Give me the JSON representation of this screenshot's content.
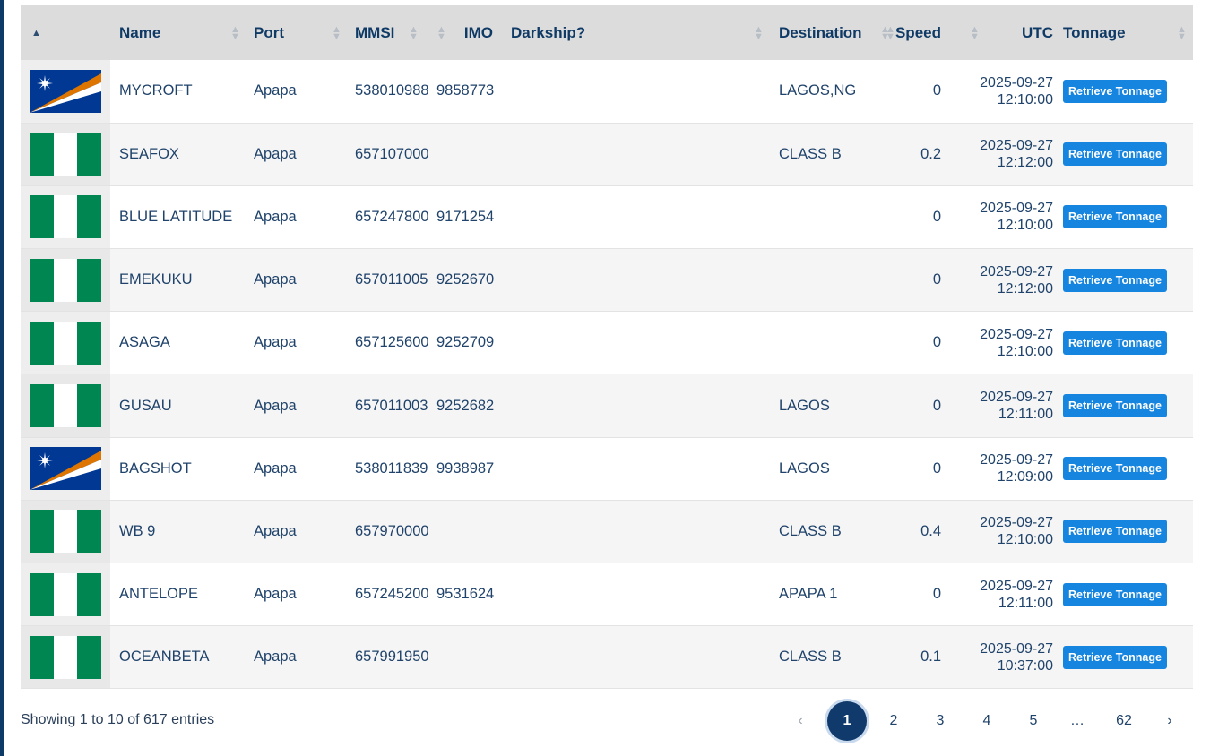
{
  "columns": {
    "name": "Name",
    "port": "Port",
    "mmsi": "MMSI",
    "imo": "IMO",
    "darkship": "Darkship?",
    "destination": "Destination",
    "speed": "Speed",
    "utc": "UTC",
    "tonnage": "Tonnage"
  },
  "button_label": "Retrieve Tonnage",
  "rows": [
    {
      "flag": "marshall-islands",
      "name": "MYCROFT",
      "port": "Apapa",
      "mmsi": "538010988",
      "imo": "9858773",
      "darkship": "",
      "destination": "LAGOS,NG",
      "speed": "0",
      "utc_date": "2025-09-27",
      "utc_time": "12:10:00"
    },
    {
      "flag": "nigeria",
      "name": "SEAFOX",
      "port": "Apapa",
      "mmsi": "657107000",
      "imo": "",
      "darkship": "",
      "destination": "CLASS B",
      "speed": "0.2",
      "utc_date": "2025-09-27",
      "utc_time": "12:12:00"
    },
    {
      "flag": "nigeria",
      "name": "BLUE LATITUDE",
      "port": "Apapa",
      "mmsi": "657247800",
      "imo": "9171254",
      "darkship": "",
      "destination": "",
      "speed": "0",
      "utc_date": "2025-09-27",
      "utc_time": "12:10:00"
    },
    {
      "flag": "nigeria",
      "name": "EMEKUKU",
      "port": "Apapa",
      "mmsi": "657011005",
      "imo": "9252670",
      "darkship": "",
      "destination": "",
      "speed": "0",
      "utc_date": "2025-09-27",
      "utc_time": "12:12:00"
    },
    {
      "flag": "nigeria",
      "name": "ASAGA",
      "port": "Apapa",
      "mmsi": "657125600",
      "imo": "9252709",
      "darkship": "",
      "destination": "",
      "speed": "0",
      "utc_date": "2025-09-27",
      "utc_time": "12:10:00"
    },
    {
      "flag": "nigeria",
      "name": "GUSAU",
      "port": "Apapa",
      "mmsi": "657011003",
      "imo": "9252682",
      "darkship": "",
      "destination": "LAGOS",
      "speed": "0",
      "utc_date": "2025-09-27",
      "utc_time": "12:11:00"
    },
    {
      "flag": "marshall-islands",
      "name": "BAGSHOT",
      "port": "Apapa",
      "mmsi": "538011839",
      "imo": "9938987",
      "darkship": "",
      "destination": "LAGOS",
      "speed": "0",
      "utc_date": "2025-09-27",
      "utc_time": "12:09:00"
    },
    {
      "flag": "nigeria",
      "name": "WB 9",
      "port": "Apapa",
      "mmsi": "657970000",
      "imo": "",
      "darkship": "",
      "destination": "CLASS B",
      "speed": "0.4",
      "utc_date": "2025-09-27",
      "utc_time": "12:10:00"
    },
    {
      "flag": "nigeria",
      "name": "ANTELOPE",
      "port": "Apapa",
      "mmsi": "657245200",
      "imo": "9531624",
      "darkship": "",
      "destination": "APAPA 1",
      "speed": "0",
      "utc_date": "2025-09-27",
      "utc_time": "12:11:00"
    },
    {
      "flag": "nigeria",
      "name": "OCEANBETA",
      "port": "Apapa",
      "mmsi": "657991950",
      "imo": "",
      "darkship": "",
      "destination": "CLASS B",
      "speed": "0.1",
      "utc_date": "2025-09-27",
      "utc_time": "10:37:00"
    }
  ],
  "footer": {
    "info": "Showing 1 to 10 of 617 entries",
    "pagination": {
      "prev": "‹",
      "pages": [
        "1",
        "2",
        "3",
        "4",
        "5"
      ],
      "current": "1",
      "ellipsis": "…",
      "last": "62",
      "next": "›"
    }
  },
  "colors": {
    "nigeria_green": "#008751",
    "marshall_blue": "#003893",
    "marshall_orange": "#dd7500",
    "button": "#1585e0",
    "header_bg": "#dcdcdc",
    "page_current": "#0f3a6b"
  }
}
